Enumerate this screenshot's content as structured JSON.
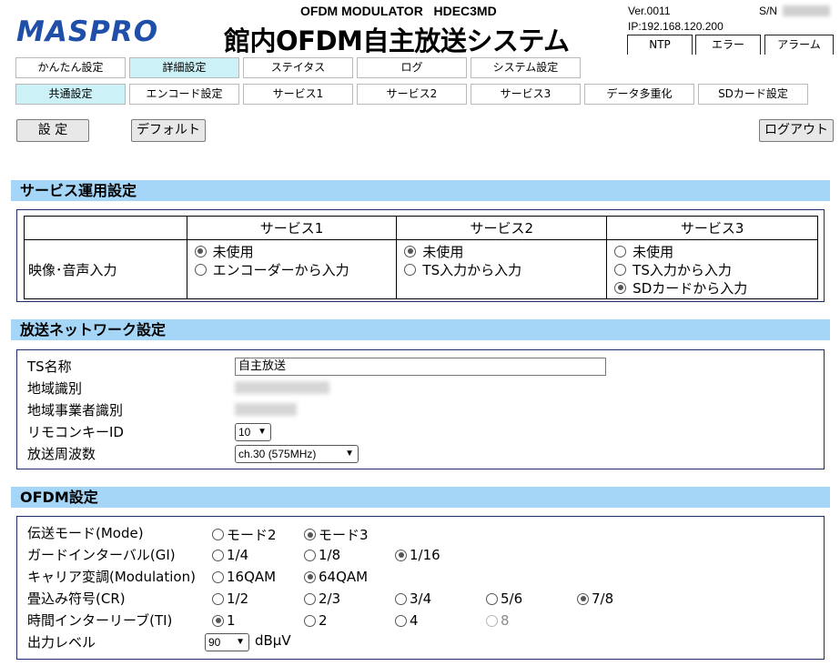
{
  "header": {
    "logo": "MASPRO",
    "model": "OFDM MODULATOR   HDEC3MD",
    "system_title": "館内OFDM自主放送システム",
    "version": "Ver.0011",
    "ip": "IP:192.168.120.200",
    "sn_label": "S/N",
    "status_buttons": [
      "NTP",
      "エラー",
      "アラーム"
    ]
  },
  "main_tabs": [
    "かんたん設定",
    "詳細設定",
    "ステイタス",
    "ログ",
    "システム設定"
  ],
  "main_tab_active": "詳細設定",
  "sub_tabs": [
    "共通設定",
    "エンコード設定",
    "サービス1",
    "サービス2",
    "サービス3",
    "データ多重化",
    "SDカード設定"
  ],
  "sub_tab_active": "共通設定",
  "toolbar": {
    "set": "設 定",
    "default": "デフォルト",
    "logout": "ログアウト"
  },
  "service_section": {
    "title": "サービス運用設定",
    "columns": [
      "",
      "サービス1",
      "サービス2",
      "サービス3"
    ],
    "row_label": "映像･音声入力",
    "service1": [
      {
        "label": "未使用",
        "checked": true
      },
      {
        "label": "エンコーダーから入力",
        "checked": false
      }
    ],
    "service2": [
      {
        "label": "未使用",
        "checked": true
      },
      {
        "label": "TS入力から入力",
        "checked": false
      }
    ],
    "service3": [
      {
        "label": "未使用",
        "checked": false
      },
      {
        "label": "TS入力から入力",
        "checked": false
      },
      {
        "label": "SDカードから入力",
        "checked": true
      }
    ]
  },
  "network_section": {
    "title": "放送ネットワーク設定",
    "ts_name_label": "TS名称",
    "ts_name_value": "自主放送",
    "region_label": "地域識別",
    "operator_label": "地域事業者識別",
    "remote_key_label": "リモコンキーID",
    "remote_key_value": "10",
    "frequency_label": "放送周波数",
    "frequency_value": "ch.30 (575MHz)"
  },
  "ofdm_section": {
    "title": "OFDM設定",
    "mode_label": "伝送モード(Mode)",
    "mode_options": [
      {
        "label": "モード2",
        "checked": false
      },
      {
        "label": "モード3",
        "checked": true
      }
    ],
    "gi_label": "ガードインターバル(GI)",
    "gi_options": [
      {
        "label": "1/4",
        "checked": false
      },
      {
        "label": "1/8",
        "checked": false
      },
      {
        "label": "1/16",
        "checked": true
      }
    ],
    "mod_label": "キャリア変調(Modulation)",
    "mod_options": [
      {
        "label": "16QAM",
        "checked": false
      },
      {
        "label": "64QAM",
        "checked": true
      }
    ],
    "cr_label": "畳込み符号(CR)",
    "cr_options": [
      {
        "label": "1/2",
        "checked": false
      },
      {
        "label": "2/3",
        "checked": false
      },
      {
        "label": "3/4",
        "checked": false
      },
      {
        "label": "5/6",
        "checked": false
      },
      {
        "label": "7/8",
        "checked": true
      }
    ],
    "ti_label": "時間インターリーブ(TI)",
    "ti_options": [
      {
        "label": "1",
        "checked": true
      },
      {
        "label": "2",
        "checked": false
      },
      {
        "label": "4",
        "checked": false
      },
      {
        "label": "8",
        "checked": false,
        "disabled": true
      }
    ],
    "output_label": "出力レベル",
    "output_value": "90",
    "output_unit": "dBμV"
  }
}
